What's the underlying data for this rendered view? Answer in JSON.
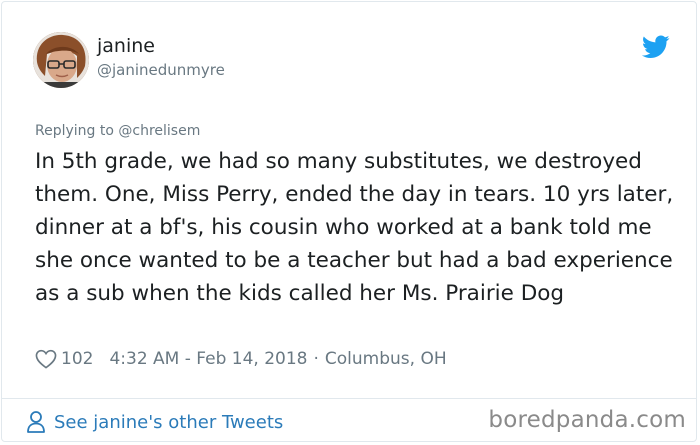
{
  "author": {
    "display_name": "janine",
    "handle": "@janinedunmyre"
  },
  "tweet": {
    "replying_to": "Replying to @chrelisem",
    "text": "In 5th grade, we had so many substitutes, we destroyed them. One, Miss Perry, ended the day in tears. 10 yrs later, dinner at a bf's, his cousin who worked at a bank told me she once wanted to be a teacher but had a bad experience as a sub when the kids called her Ms. Prairie Dog",
    "like_count": "102",
    "timestamp": "4:32 AM - Feb 14, 2018",
    "separator": "·",
    "location": "Columbus, OH"
  },
  "footer": {
    "see_other_label": "See janine's other Tweets",
    "watermark": "boredpanda.com"
  },
  "icons": {
    "logo": "twitter-bird-icon",
    "like": "heart-icon",
    "profile": "person-icon"
  },
  "colors": {
    "twitter_blue": "#1da1f2",
    "link_blue": "#2b7bb9",
    "text": "#1c2022",
    "secondary_text": "#697882",
    "border": "#e1e8ed"
  }
}
